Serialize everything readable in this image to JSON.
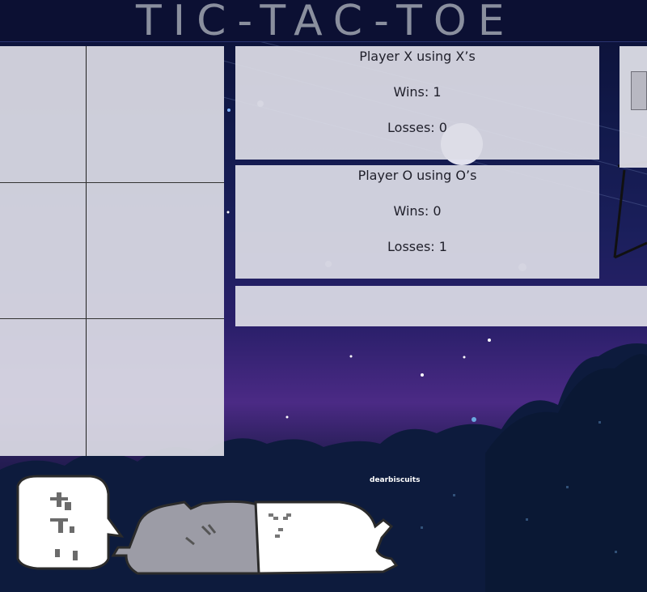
{
  "header": {
    "title": "TIC-TAC-TOE"
  },
  "board": {
    "cells": [
      "",
      "",
      "",
      "",
      "",
      ""
    ]
  },
  "players": [
    {
      "name": "Player X using X’s",
      "wins": "Wins: 1",
      "losses": "Losses: 0"
    },
    {
      "name": "Player O using O’s",
      "wins": "Wins: 0",
      "losses": "Losses: 1"
    }
  ],
  "status": {
    "message": ""
  },
  "footer": {
    "credit": "dearbiscuits"
  },
  "colors": {
    "panel": "#dcdce6",
    "header": "#0c1033",
    "title": "#8a8f9e",
    "sky_purple": "#4b2a85"
  }
}
